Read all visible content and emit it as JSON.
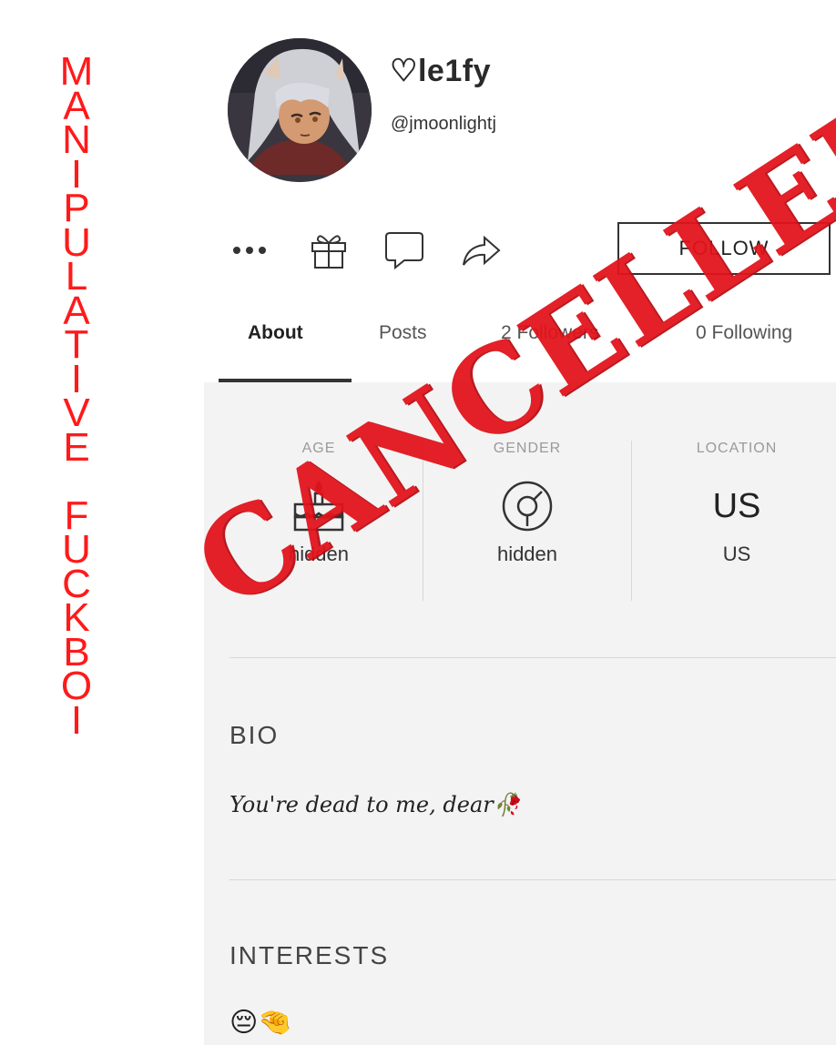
{
  "side_caption": {
    "line1": [
      "M",
      "A",
      "N",
      "I",
      "P",
      "U",
      "L",
      "A",
      "T",
      "I",
      "V",
      "E"
    ],
    "line2": [
      "F",
      "U",
      "C",
      "K",
      "B",
      "O",
      "I"
    ]
  },
  "profile": {
    "display_name": "♡le1fy",
    "handle": "@jmoonlightj",
    "avatar_icon": "avatar-image"
  },
  "actions": {
    "icons": [
      "more-icon",
      "gift-icon",
      "message-icon",
      "share-icon"
    ],
    "follow_label": "FOLLOW"
  },
  "tabs": [
    {
      "label": "About",
      "active": true
    },
    {
      "label": "Posts",
      "active": false
    },
    {
      "label": "2 Followers",
      "active": false
    },
    {
      "label": "0 Following",
      "active": false
    }
  ],
  "stats": {
    "age": {
      "label": "AGE",
      "value": "hidden",
      "icon": "cake-icon"
    },
    "gender": {
      "label": "GENDER",
      "value": "hidden",
      "icon": "gender-icon"
    },
    "location": {
      "label": "LOCATION",
      "big": "US",
      "value": "US"
    }
  },
  "bio": {
    "title": "BIO",
    "text": "You're dead to me, dear🥀"
  },
  "interests": {
    "title": "INTERESTS",
    "emojis": "😔🤏"
  },
  "stamp": {
    "text": "CANCELLED",
    "color": "#e3131b"
  },
  "colors": {
    "caption": "#ff1a1a",
    "panel_bg": "#f3f3f3"
  }
}
